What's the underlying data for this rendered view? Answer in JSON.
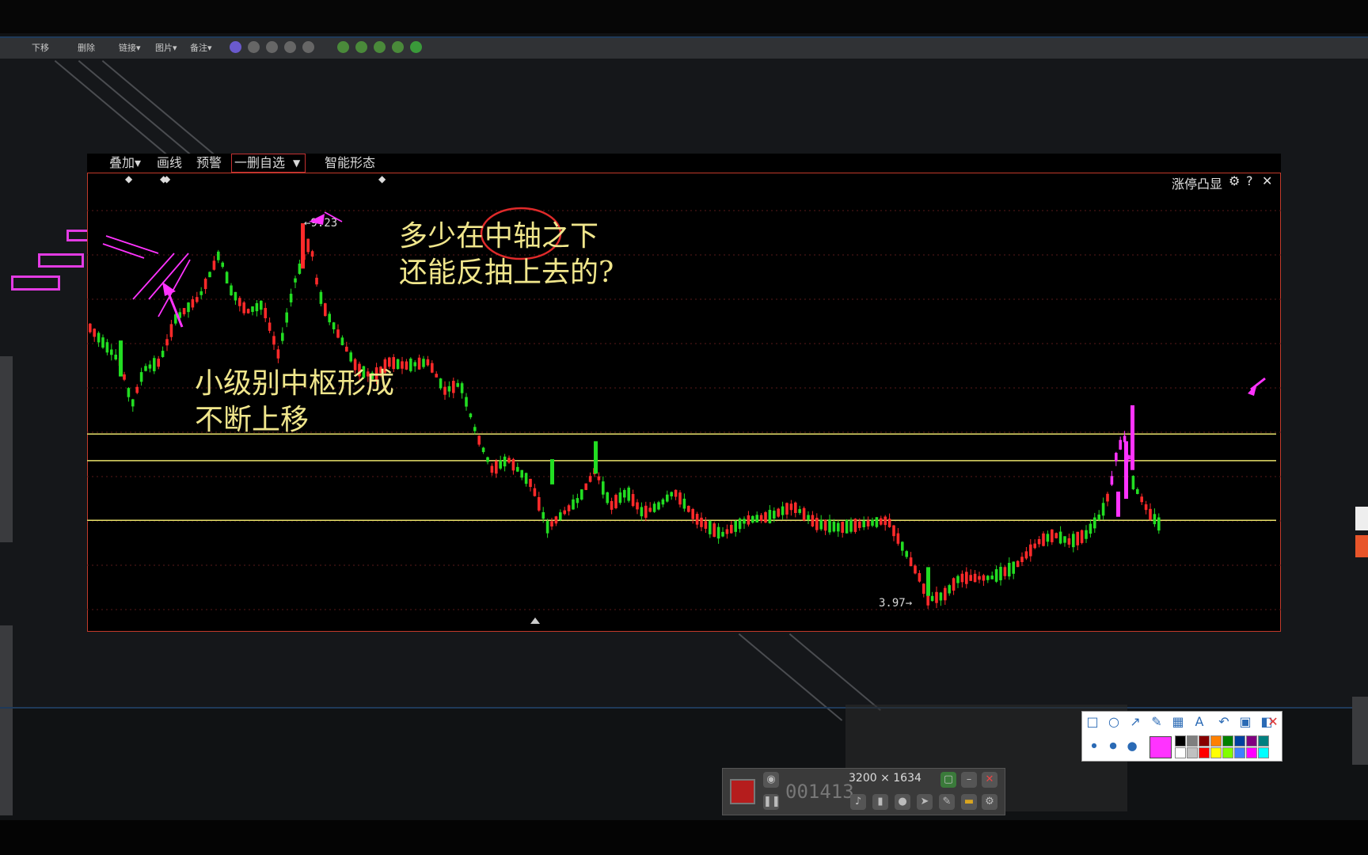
{
  "doc_toolbar": {
    "items": [
      "下移",
      "删除",
      "链接▾",
      "图片▾",
      "备注▾"
    ],
    "pager_dots": [
      "1",
      "2",
      "3",
      "4",
      "5"
    ]
  },
  "app_toolbar": {
    "items": [
      "叠加▾",
      "画线",
      "预警",
      "一删自选",
      "智能形态"
    ],
    "selected": "一删自选"
  },
  "chart_panel": {
    "top_right_label": "涨停凸显",
    "help": "?",
    "close": "✕",
    "high_label": "←9.23",
    "low_label": "3.97→"
  },
  "annotations": {
    "top_text": "多少在中轴之下\n还能反抽上去的?",
    "left_text": "小级别中枢形成\n不断上移",
    "circled_word": "中轴"
  },
  "recorder": {
    "timer": "001413",
    "resolution": "3200 × 1634"
  },
  "palette": {
    "current_color": "#ff33ff",
    "swatches": [
      "#000000",
      "#7f7f7f",
      "#880000",
      "#ff8000",
      "#008000",
      "#00409f",
      "#800080",
      "#008080",
      "#ffffff",
      "#c0c0c0",
      "#ff0000",
      "#ffff00",
      "#80ff00",
      "#4080ff",
      "#ff00ff",
      "#00ffff"
    ]
  },
  "colors": {
    "up_candle": "#ff2a2a",
    "down_candle": "#22dd22",
    "pivot_line": "#e8e06a",
    "annotation_text": "#f0e68c",
    "markup_pink": "#ff33ff"
  },
  "chart_data": {
    "type": "candlestick",
    "high": 9.23,
    "low": 3.97,
    "horizontal_lines": [
      "pivot-upper",
      "pivot-middle",
      "pivot-lower"
    ]
  }
}
